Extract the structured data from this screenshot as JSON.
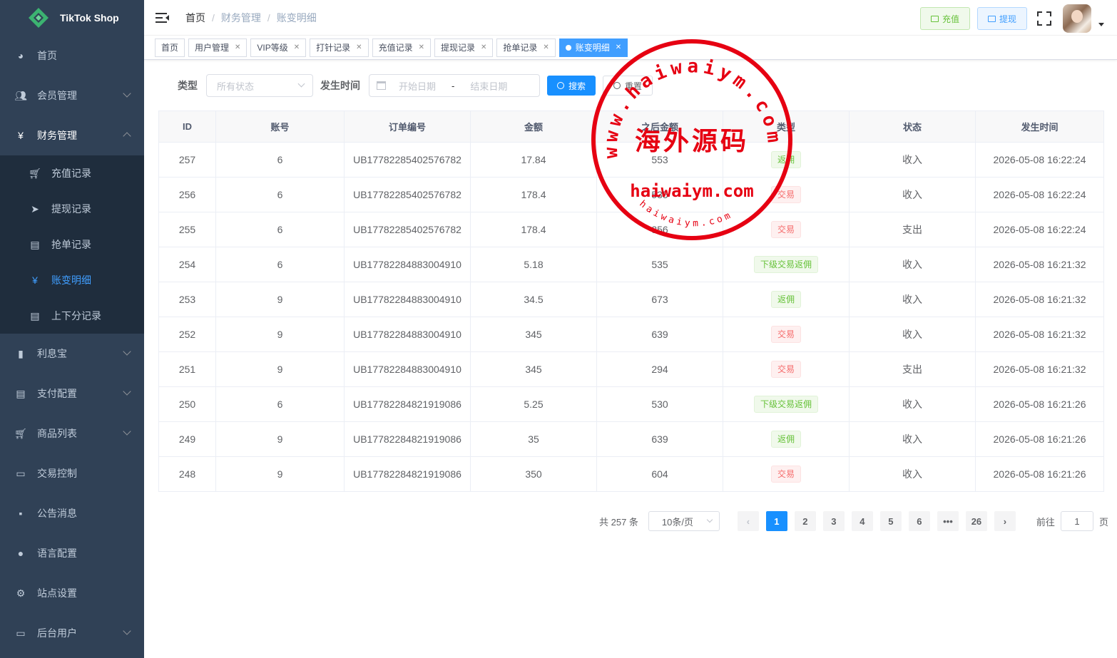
{
  "sidebar": {
    "brand": "TikTok Shop",
    "items": [
      {
        "label": "首页",
        "icon": "dashboard-icon"
      },
      {
        "label": "会员管理",
        "icon": "user-icon"
      },
      {
        "label": "财务管理",
        "icon": "yen-icon"
      },
      {
        "label": "利息宝",
        "icon": "chart-icon"
      },
      {
        "label": "支付配置",
        "icon": "doc-icon"
      },
      {
        "label": "商品列表",
        "icon": "cart-icon"
      },
      {
        "label": "交易控制",
        "icon": "monitor-icon"
      },
      {
        "label": "公告消息",
        "icon": "message-icon"
      },
      {
        "label": "语言配置",
        "icon": "globe-icon"
      },
      {
        "label": "站点设置",
        "icon": "gear-icon"
      },
      {
        "label": "后台用户",
        "icon": "monitor-icon"
      }
    ],
    "finance_sub": [
      {
        "label": "充值记录"
      },
      {
        "label": "提现记录"
      },
      {
        "label": "抢单记录"
      },
      {
        "label": "账变明细"
      },
      {
        "label": "上下分记录"
      }
    ]
  },
  "navbar": {
    "breadcrumb": [
      "首页",
      "财务管理",
      "账变明细"
    ],
    "recharge": "充值",
    "withdraw": "提现"
  },
  "tags": [
    "首页",
    "用户管理",
    "VIP等级",
    "打针记录",
    "充值记录",
    "提现记录",
    "抢单记录",
    "账变明细"
  ],
  "filter": {
    "type_label": "类型",
    "type_placeholder": "所有状态",
    "time_label": "发生时间",
    "start_placeholder": "开始日期",
    "end_placeholder": "结束日期",
    "dash": "-",
    "search": "搜索",
    "reset": "重置"
  },
  "table": {
    "headers": [
      "ID",
      "账号",
      "订单编号",
      "金额",
      "之后金额",
      "类型",
      "状态",
      "发生时间"
    ],
    "rows": [
      {
        "id": "257",
        "account": "6",
        "order": "UB17782285402576782",
        "amount": "17.84",
        "after": "553",
        "type": "返佣",
        "color": "green",
        "status": "收入",
        "time": "2026-05-08 16:22:24"
      },
      {
        "id": "256",
        "account": "6",
        "order": "UB17782285402576782",
        "amount": "178.4",
        "after": "535",
        "type": "交易",
        "color": "red",
        "status": "收入",
        "time": "2026-05-08 16:22:24"
      },
      {
        "id": "255",
        "account": "6",
        "order": "UB17782285402576782",
        "amount": "178.4",
        "after": "356",
        "type": "交易",
        "color": "red",
        "status": "支出",
        "time": "2026-05-08 16:22:24"
      },
      {
        "id": "254",
        "account": "6",
        "order": "UB17782284883004910",
        "amount": "5.18",
        "after": "535",
        "type": "下级交易返佣",
        "color": "green",
        "status": "收入",
        "time": "2026-05-08 16:21:32"
      },
      {
        "id": "253",
        "account": "9",
        "order": "UB17782284883004910",
        "amount": "34.5",
        "after": "673",
        "type": "返佣",
        "color": "green",
        "status": "收入",
        "time": "2026-05-08 16:21:32"
      },
      {
        "id": "252",
        "account": "9",
        "order": "UB17782284883004910",
        "amount": "345",
        "after": "639",
        "type": "交易",
        "color": "red",
        "status": "收入",
        "time": "2026-05-08 16:21:32"
      },
      {
        "id": "251",
        "account": "9",
        "order": "UB17782284883004910",
        "amount": "345",
        "after": "294",
        "type": "交易",
        "color": "red",
        "status": "支出",
        "time": "2026-05-08 16:21:32"
      },
      {
        "id": "250",
        "account": "6",
        "order": "UB17782284821919086",
        "amount": "5.25",
        "after": "530",
        "type": "下级交易返佣",
        "color": "green",
        "status": "收入",
        "time": "2026-05-08 16:21:26"
      },
      {
        "id": "249",
        "account": "9",
        "order": "UB17782284821919086",
        "amount": "35",
        "after": "639",
        "type": "返佣",
        "color": "green",
        "status": "收入",
        "time": "2026-05-08 16:21:26"
      },
      {
        "id": "248",
        "account": "9",
        "order": "UB17782284821919086",
        "amount": "350",
        "after": "604",
        "type": "交易",
        "color": "red",
        "status": "收入",
        "time": "2026-05-08 16:21:26"
      }
    ]
  },
  "pagination": {
    "total": "共 257 条",
    "page_size": "10条/页",
    "pages": [
      "1",
      "2",
      "3",
      "4",
      "5",
      "6",
      "•••",
      "26"
    ],
    "prev": "‹",
    "next": "›",
    "goto_label": "前往",
    "goto_value": "1",
    "goto_suffix": "页"
  },
  "watermark": {
    "top_arc": "www.haiwaiym.com",
    "center": "海外源码",
    "domain": "haiwaiym.com",
    "bottom_arc": "haiwaiym.com",
    "color": "#e60012"
  }
}
